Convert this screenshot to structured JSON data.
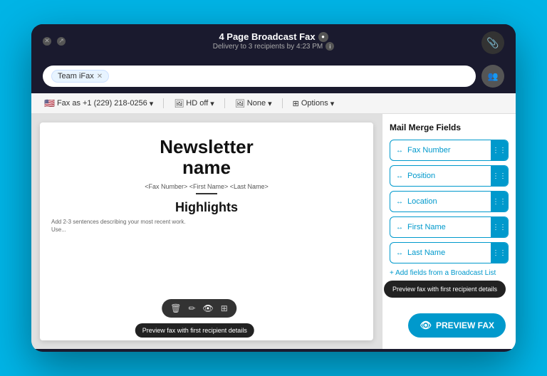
{
  "window": {
    "title": "4 Page Broadcast Fax",
    "title_badge": "●",
    "subtitle": "Delivery to 3 recipients by 4:23 PM",
    "info_icon": "i"
  },
  "buttons": {
    "close": "✕",
    "restore": "↗",
    "attach": "📎",
    "contacts": "👥"
  },
  "recipient": {
    "team_tag": "Team iFax",
    "tag_close": "✕"
  },
  "toolbar": {
    "fax_as": "Fax as",
    "phone": "+1 (229) 218-0256",
    "hd": "HD off",
    "none": "None",
    "options": "Options"
  },
  "document": {
    "newsletter_title_line1": "Newsletter",
    "newsletter_title_line2": "name",
    "fields_row": "<Fax Number>  <First Name>  <Last Name>",
    "highlights": "Highlights",
    "body_text_line1": "Add 2-3 sentences describing your most recent work.",
    "body_text_line2": "Use..."
  },
  "doc_toolbar": {
    "delete": "🗑",
    "edit": "✏",
    "view": "👁",
    "grid": "⊞"
  },
  "doc_tooltip": "Preview fax with first recipient details",
  "panel": {
    "title": "Mail Merge Fields",
    "fields": [
      {
        "label": "Fax Number",
        "icon": "↔"
      },
      {
        "label": "Position",
        "icon": "↔"
      },
      {
        "label": "Location",
        "icon": "↔"
      },
      {
        "label": "First Name",
        "icon": "↔"
      },
      {
        "label": "Last Name",
        "icon": "↔"
      }
    ],
    "add_fields": "+ Add fields from a Broadcast List"
  },
  "preview_tooltip": "Preview fax with first recipient details",
  "preview_btn": "PREVIEW FAX",
  "icons": {
    "grip": "⋮⋮",
    "eye": "👁"
  }
}
